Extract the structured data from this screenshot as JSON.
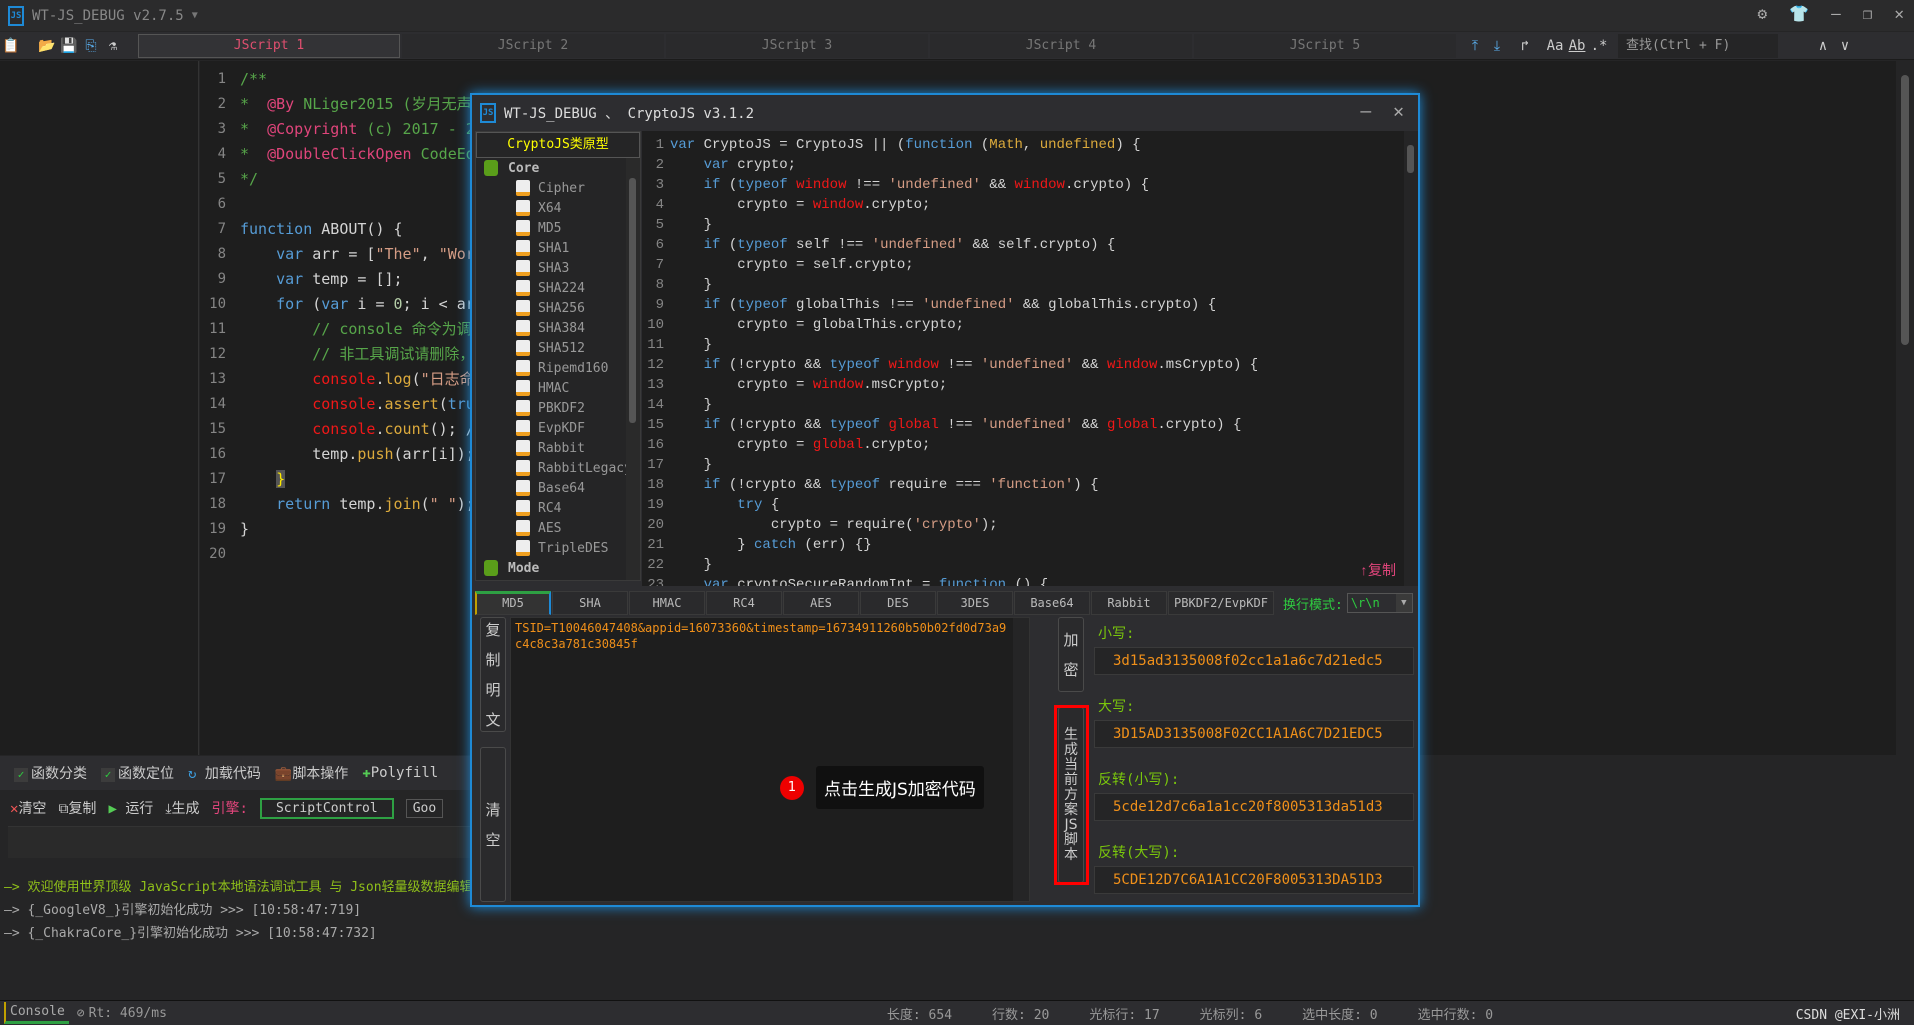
{
  "app": {
    "title": "WT-JS_DEBUG v2.7.5",
    "logo": "JS"
  },
  "toolbar": {
    "script_tabs": [
      "JScript 1",
      "JScript 2",
      "JScript 3",
      "JScript 4",
      "JScript 5"
    ],
    "active_tab": 0,
    "find_placeholder": "查找(Ctrl + F)",
    "format_icons": [
      "Aa",
      "Ab",
      ".*"
    ]
  },
  "editor": {
    "lines": [
      [
        [
          "c",
          "/**"
        ]
      ],
      [
        [
          "c",
          "*  "
        ],
        [
          "a",
          "@By"
        ],
        [
          "c",
          " NLiger2015 (岁月无声"
        ]
      ],
      [
        [
          "c",
          "*  "
        ],
        [
          "a",
          "@Copyright"
        ],
        [
          "c",
          " (c) 2017 - 2"
        ]
      ],
      [
        [
          "c",
          "*  "
        ],
        [
          "a",
          "@DoubleClickOpen"
        ],
        [
          "c",
          " CodeEd"
        ]
      ],
      [
        [
          "c",
          "*/"
        ]
      ],
      [],
      [
        [
          "k",
          "function"
        ],
        [
          "n",
          " ABOUT() {"
        ]
      ],
      [
        [
          "n",
          "    "
        ],
        [
          "k",
          "var"
        ],
        [
          "n",
          " arr = ["
        ],
        [
          "s",
          "\"The\""
        ],
        [
          "n",
          ", "
        ],
        [
          "s",
          "\"Wor"
        ]
      ],
      [
        [
          "n",
          "    "
        ],
        [
          "k",
          "var"
        ],
        [
          "n",
          " temp = [];"
        ]
      ],
      [
        [
          "n",
          "    "
        ],
        [
          "k",
          "for"
        ],
        [
          "n",
          " ("
        ],
        [
          "k",
          "var"
        ],
        [
          "n",
          " i = "
        ],
        [
          "num",
          "0"
        ],
        [
          "n",
          "; i < ar"
        ]
      ],
      [
        [
          "n",
          "        "
        ],
        [
          "c",
          "// console 命令为调"
        ]
      ],
      [
        [
          "n",
          "        "
        ],
        [
          "c",
          "// 非工具调试请删除，"
        ]
      ],
      [
        [
          "n",
          "        "
        ],
        [
          "r",
          "console"
        ],
        [
          "n",
          "."
        ],
        [
          "f",
          "log"
        ],
        [
          "n",
          "("
        ],
        [
          "s",
          "\"日志命"
        ]
      ],
      [
        [
          "n",
          "        "
        ],
        [
          "r",
          "console"
        ],
        [
          "n",
          "."
        ],
        [
          "f",
          "assert"
        ],
        [
          "n",
          "("
        ],
        [
          "k",
          "tru"
        ]
      ],
      [
        [
          "n",
          "        "
        ],
        [
          "r",
          "console"
        ],
        [
          "n",
          "."
        ],
        [
          "f",
          "count"
        ],
        [
          "n",
          "(); /"
        ]
      ],
      [
        [
          "n",
          "        temp."
        ],
        [
          "f",
          "push"
        ],
        [
          "n",
          "(arr[i]);"
        ]
      ],
      [
        [
          "n",
          "    "
        ],
        [
          "hl",
          "}"
        ]
      ],
      [
        [
          "n",
          "    "
        ],
        [
          "k",
          "return"
        ],
        [
          "n",
          " temp."
        ],
        [
          "f",
          "join"
        ],
        [
          "n",
          "("
        ],
        [
          "s",
          "\" \""
        ],
        [
          "n",
          ");"
        ]
      ],
      [
        [
          "n",
          "}"
        ]
      ],
      []
    ]
  },
  "function_tools": {
    "items": [
      {
        "label": "函数分类",
        "checked": true
      },
      {
        "label": "函数定位",
        "checked": true
      },
      {
        "label": "加载代码",
        "icon": "reload-icon"
      },
      {
        "label": "脚本操作",
        "icon": "briefcase-icon"
      },
      {
        "label": "Polyfill",
        "icon": "puzzle-icon"
      }
    ]
  },
  "run_tools": {
    "clear": "清空",
    "copy": "复制",
    "run": "运行",
    "generate": "生成",
    "engine_label": "引擎:",
    "engine_value": "ScriptControl",
    "engine2_value": "Goo"
  },
  "log": [
    "—> 欢迎使用世界顶级 JavaScript本地语法调试工具 与 Json轻量级数据编辑器 By: NLiger2015 、 2022.08.17 [自动更新版]",
    "—> {_GoogleV8_}引擎初始化成功 >>> [10:58:47:719]",
    "—> {_ChakraCore_}引擎初始化成功 >>> [10:58:47:732]"
  ],
  "statusbar": {
    "console_tab": "Console",
    "rt": "Rt: 469/ms",
    "length": "长度: 654",
    "lines": "行数: 20",
    "cursor_row": "光标行: 17",
    "cursor_col": "光标列: 6",
    "sel_length": "选中长度: 0",
    "sel_lines": "选中行数: 0",
    "watermark": "CSDN @EXI-小洲"
  },
  "dialog": {
    "title": "WT-JS_DEBUG 、 CryptoJS v3.1.2",
    "tree_header": "CryptoJS类原型",
    "tree": [
      {
        "label": "Core",
        "group": true
      },
      {
        "label": "Cipher"
      },
      {
        "label": "X64"
      },
      {
        "label": "MD5"
      },
      {
        "label": "SHA1"
      },
      {
        "label": "SHA3"
      },
      {
        "label": "SHA224"
      },
      {
        "label": "SHA256"
      },
      {
        "label": "SHA384"
      },
      {
        "label": "SHA512"
      },
      {
        "label": "Ripemd160"
      },
      {
        "label": "HMAC"
      },
      {
        "label": "PBKDF2"
      },
      {
        "label": "EvpKDF"
      },
      {
        "label": "Rabbit"
      },
      {
        "label": "RabbitLegacy"
      },
      {
        "label": "Base64"
      },
      {
        "label": "RC4"
      },
      {
        "label": "AES"
      },
      {
        "label": "TripleDES"
      },
      {
        "label": "Mode",
        "group": true
      }
    ],
    "code": [
      [
        [
          "k",
          "var"
        ],
        [
          "n",
          " CryptoJS = CryptoJS || ("
        ],
        [
          "k",
          "function"
        ],
        [
          "n",
          " ("
        ],
        [
          "f",
          "Math"
        ],
        [
          "n",
          ", "
        ],
        [
          "f",
          "undefined"
        ],
        [
          "n",
          ") {"
        ]
      ],
      [
        [
          "n",
          "    "
        ],
        [
          "k",
          "var"
        ],
        [
          "n",
          " crypto;"
        ]
      ],
      [
        [
          "n",
          "    "
        ],
        [
          "k",
          "if"
        ],
        [
          "n",
          " ("
        ],
        [
          "k",
          "typeof"
        ],
        [
          "n",
          " "
        ],
        [
          "r",
          "window"
        ],
        [
          "n",
          " !== "
        ],
        [
          "s",
          "'undefined'"
        ],
        [
          "n",
          " && "
        ],
        [
          "r",
          "window"
        ],
        [
          "n",
          ".crypto) {"
        ]
      ],
      [
        [
          "n",
          "        crypto = "
        ],
        [
          "r",
          "window"
        ],
        [
          "n",
          ".crypto;"
        ]
      ],
      [
        [
          "n",
          "    }"
        ]
      ],
      [
        [
          "n",
          "    "
        ],
        [
          "k",
          "if"
        ],
        [
          "n",
          " ("
        ],
        [
          "k",
          "typeof"
        ],
        [
          "n",
          " self !== "
        ],
        [
          "s",
          "'undefined'"
        ],
        [
          "n",
          " && self.crypto) {"
        ]
      ],
      [
        [
          "n",
          "        crypto = self.crypto;"
        ]
      ],
      [
        [
          "n",
          "    }"
        ]
      ],
      [
        [
          "n",
          "    "
        ],
        [
          "k",
          "if"
        ],
        [
          "n",
          " ("
        ],
        [
          "k",
          "typeof"
        ],
        [
          "n",
          " globalThis !== "
        ],
        [
          "s",
          "'undefined'"
        ],
        [
          "n",
          " && globalThis.crypto) {"
        ]
      ],
      [
        [
          "n",
          "        crypto = globalThis.crypto;"
        ]
      ],
      [
        [
          "n",
          "    }"
        ]
      ],
      [
        [
          "n",
          "    "
        ],
        [
          "k",
          "if"
        ],
        [
          "n",
          " (!crypto && "
        ],
        [
          "k",
          "typeof"
        ],
        [
          "n",
          " "
        ],
        [
          "r",
          "window"
        ],
        [
          "n",
          " !== "
        ],
        [
          "s",
          "'undefined'"
        ],
        [
          "n",
          " && "
        ],
        [
          "r",
          "window"
        ],
        [
          "n",
          ".msCrypto) {"
        ]
      ],
      [
        [
          "n",
          "        crypto = "
        ],
        [
          "r",
          "window"
        ],
        [
          "n",
          ".msCrypto;"
        ]
      ],
      [
        [
          "n",
          "    }"
        ]
      ],
      [
        [
          "n",
          "    "
        ],
        [
          "k",
          "if"
        ],
        [
          "n",
          " (!crypto && "
        ],
        [
          "k",
          "typeof"
        ],
        [
          "n",
          " "
        ],
        [
          "r",
          "global"
        ],
        [
          "n",
          " !== "
        ],
        [
          "s",
          "'undefined'"
        ],
        [
          "n",
          " && "
        ],
        [
          "r",
          "global"
        ],
        [
          "n",
          ".crypto) {"
        ]
      ],
      [
        [
          "n",
          "        crypto = "
        ],
        [
          "r",
          "global"
        ],
        [
          "n",
          ".crypto;"
        ]
      ],
      [
        [
          "n",
          "    }"
        ]
      ],
      [
        [
          "n",
          "    "
        ],
        [
          "k",
          "if"
        ],
        [
          "n",
          " (!crypto && "
        ],
        [
          "k",
          "typeof"
        ],
        [
          "n",
          " require === "
        ],
        [
          "s",
          "'function'"
        ],
        [
          "n",
          ") {"
        ]
      ],
      [
        [
          "n",
          "        "
        ],
        [
          "k",
          "try"
        ],
        [
          "n",
          " {"
        ]
      ],
      [
        [
          "n",
          "            crypto = require("
        ],
        [
          "s",
          "'crypto'"
        ],
        [
          "n",
          ");"
        ]
      ],
      [
        [
          "n",
          "        } "
        ],
        [
          "k",
          "catch"
        ],
        [
          "n",
          " (err) {}"
        ]
      ],
      [
        [
          "n",
          "    }"
        ]
      ],
      [
        [
          "n",
          "    "
        ],
        [
          "k",
          "var"
        ],
        [
          "n",
          " cryptoSecureRandomInt = "
        ],
        [
          "k",
          "function"
        ],
        [
          "n",
          " () {"
        ]
      ]
    ],
    "copy_button": "↑复制",
    "algo_tabs": [
      "MD5",
      "SHA",
      "HMAC",
      "RC4",
      "AES",
      "DES",
      "3DES",
      "Base64",
      "Rabbit",
      "PBKDF2/EvpKDF"
    ],
    "active_algo": 0,
    "line_mode_label": "换行模式:",
    "line_mode_value": "\\r\\n",
    "copy_plain_button": "复制明文",
    "clear_button": "清空",
    "plaintext": "TSID=T10046047408&appid=16073360&timestamp=16734911260b50b02fd0d73a9c4c8c3a781c30845f",
    "encrypt_button": "加密",
    "generate_button": "生成当前方案JS脚本",
    "results": [
      {
        "label": "小写:",
        "value": "3d15ad3135008f02cc1a1a6c7d21edc5"
      },
      {
        "label": "大写:",
        "value": "3D15AD3135008F02CC1A1A6C7D21EDC5"
      },
      {
        "label": "反转(小写):",
        "value": "5cde12d7c6a1a1cc20f8005313da51d3"
      },
      {
        "label": "反转(大写):",
        "value": "5CDE12D7C6A1A1CC20F8005313DA51D3"
      }
    ]
  },
  "annotation": {
    "badge": "1",
    "text": "点击生成JS加密代码",
    "highlight_color": "#ff0000"
  },
  "colors": {
    "accent": "#1e8ad6",
    "result_text": "#f0901a",
    "label_green": "#7ac70c",
    "active_tab_text": "#e04f6f"
  }
}
